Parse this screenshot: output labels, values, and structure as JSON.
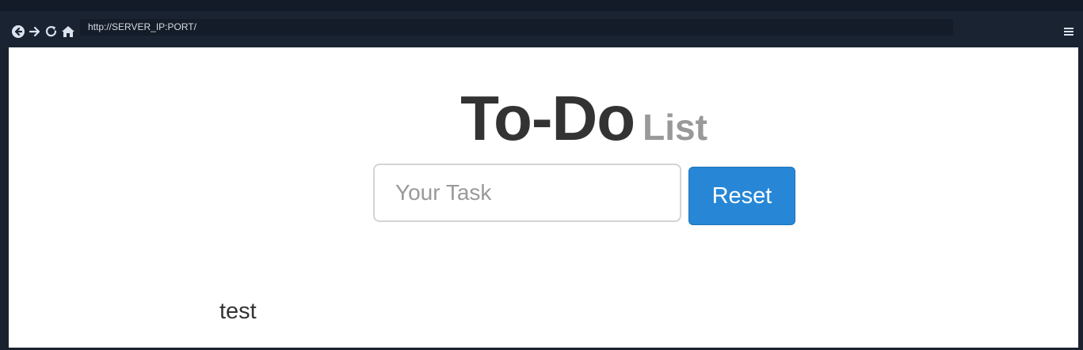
{
  "browser": {
    "address": "http://SERVER_IP:PORT/",
    "nav_icons": [
      "back-icon",
      "forward-icon",
      "reload-icon",
      "home-icon"
    ],
    "menu_icon": "hamburger-menu-icon"
  },
  "page": {
    "title_main": "To-Do",
    "title_sub": "List",
    "task_input": {
      "placeholder": "Your Task",
      "value": ""
    },
    "reset_label": "Reset",
    "items": [
      "test"
    ]
  },
  "colors": {
    "browser_chrome": "#1a2331",
    "address_bar": "#141c29",
    "page_background": "#ffffff",
    "title_main": "#333333",
    "title_sub": "#999999",
    "button_primary": "#2787d6"
  }
}
